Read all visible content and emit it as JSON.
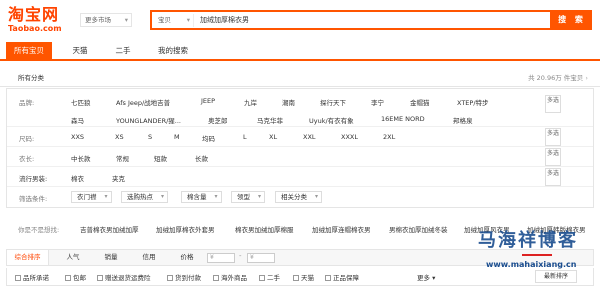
{
  "header": {
    "logo_cn": "淘宝网",
    "logo_en": "Taobao.com",
    "market_label": "更多市场",
    "search_scope": "宝贝",
    "search_value": "加绒加厚棉衣男",
    "search_button": "搜 索"
  },
  "tabs": [
    {
      "label": "所有宝贝"
    },
    {
      "label": "天猫"
    },
    {
      "label": "二手"
    },
    {
      "label": "我的搜索"
    }
  ],
  "crumb": {
    "label": "所有分类",
    "count": "共 20.96万 件宝贝"
  },
  "attributes": {
    "brand": {
      "label": "品牌:",
      "row1": [
        "七匹狼",
        "Afs Jeep/战地吉普",
        "JEEP",
        "九岸",
        "潮南",
        "探行天下",
        "李宁",
        "金帽猫",
        "XTEP/特步"
      ],
      "row2": [
        "森马",
        "YOUNGLANDER/猩...",
        "奥芝郎",
        "马克华菲",
        "Uyuk/有衣有象",
        "16EME NORD",
        "邦格泉"
      ],
      "more": "多选"
    },
    "size": {
      "label": "尺码:",
      "values": [
        "XXS",
        "XS",
        "S",
        "M",
        "均码",
        "L",
        "XL",
        "XXL",
        "XXXL",
        "2XL"
      ],
      "more": "多选"
    },
    "length": {
      "label": "衣长:",
      "values": [
        "中长款",
        "常规",
        "短款",
        "长款"
      ],
      "more": "多选"
    },
    "popular": {
      "label": "流行男装:",
      "values": [
        "棉衣",
        "夹克"
      ],
      "more": "多选"
    },
    "filter": {
      "label": "筛选条件:",
      "buttons": [
        "衣门襟",
        "选购热点",
        "棉含量",
        "领型",
        "相关分类"
      ]
    }
  },
  "suggest": {
    "label": "你是不是想找:",
    "items": [
      "吉普棉衣男加绒加厚",
      "加绒加厚棉衣外套男",
      "棉衣男加绒加厚棉服",
      "加绒加厚连帽棉衣男",
      "男棉衣加厚加绒冬装",
      "加绒加厚风衣男",
      "加绒加厚韩版棉衣男"
    ]
  },
  "sortbar": {
    "items": [
      "综合排序",
      "人气",
      "销量",
      "信用",
      "价格"
    ],
    "price_from": "¥",
    "price_to": "¥"
  },
  "checks": {
    "items": [
      "品所承诺",
      "包邮",
      "赠送退货运费险",
      "货到付款",
      "海外商品",
      "二手",
      "天猫",
      "正品保障"
    ],
    "more": "更多",
    "sort_chip": "最新排序"
  },
  "watermark": {
    "cn": "马海祥博客",
    "url": "www.mahaixiang.cn"
  },
  "colors": {
    "accent": "#ff5500",
    "brand": "#ff4400"
  }
}
